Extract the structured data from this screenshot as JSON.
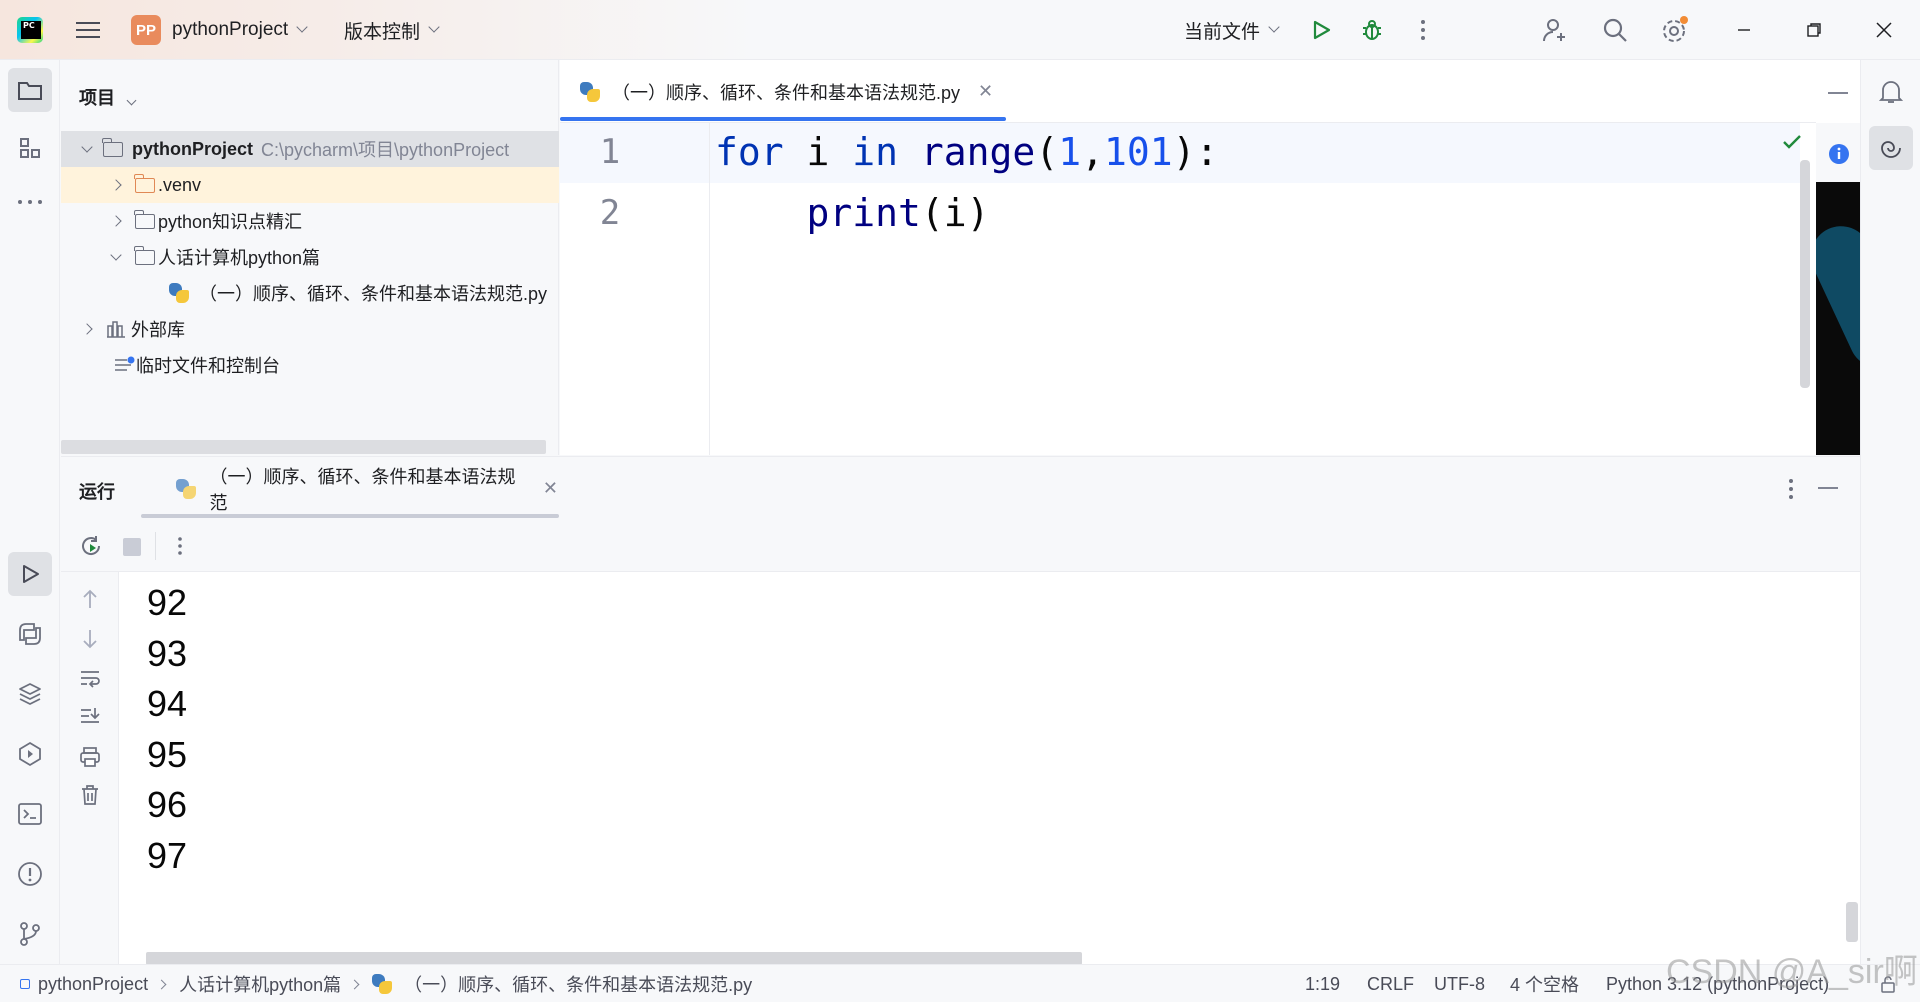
{
  "titlebar": {
    "project_badge": "PP",
    "project_name": "pythonProject",
    "vcs_menu": "版本控制",
    "run_config": "当前文件"
  },
  "project_panel": {
    "header": "项目",
    "tree": [
      {
        "label": "pythonProject",
        "path": "C:\\pycharm\\项目\\pythonProject"
      },
      {
        "label": ".venv"
      },
      {
        "label": "python知识点精汇"
      },
      {
        "label": "人话计算机python篇"
      },
      {
        "label": "（一）顺序、循环、条件和基本语法规范.py"
      },
      {
        "label": "外部库"
      },
      {
        "label": "临时文件和控制台"
      }
    ]
  },
  "editor": {
    "tab_label": "（一）顺序、循环、条件和基本语法规范.py",
    "line_numbers": [
      "1",
      "2"
    ],
    "code": {
      "l1_kw1": "for",
      "l1_var": " i ",
      "l1_kw2": "in",
      "l1_fn": " range",
      "l1_open": "(",
      "l1_n1": "1",
      "l1_comma": ",",
      "l1_n2": "101",
      "l1_close": "):",
      "l2_indent": "    ",
      "l2_fn": "print",
      "l2_args": "(i)"
    }
  },
  "run_panel": {
    "title": "运行",
    "tab_label": "（一）顺序、循环、条件和基本语法规范",
    "output_lines": [
      "92",
      "93",
      "94",
      "95",
      "96",
      "97"
    ]
  },
  "statusbar": {
    "breadcrumbs": [
      "pythonProject",
      "人话计算机python篇",
      "（一）顺序、循环、条件和基本语法规范.py"
    ],
    "position": "1:19",
    "line_ending": "CRLF",
    "encoding": "UTF-8",
    "indent": "4 个空格",
    "interpreter": "Python 3.12 (pythonProject)"
  },
  "watermark": "CSDN @A_sir啊",
  "colors": {
    "accent": "#3574f0",
    "run_green": "#208a3c",
    "keyword": "#0033b3",
    "number": "#1750eb",
    "folder_orange": "#e08855",
    "notification_dot": "#f28c35"
  }
}
